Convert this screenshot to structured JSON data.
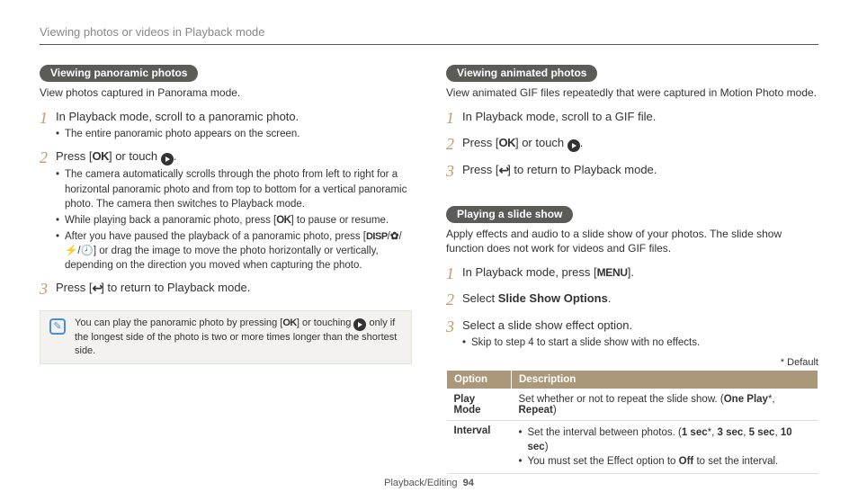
{
  "header": "Viewing photos or videos in Playback mode",
  "footer": {
    "section": "Playback/Editing",
    "page": "94"
  },
  "left": {
    "pill": "Viewing panoramic photos",
    "intro": "View photos captured in Panorama mode.",
    "step1_text": "In Playback mode, scroll to a panoramic photo.",
    "step1_b1": "The entire panoramic photo appears on the screen.",
    "step2_press": "Press [",
    "step2_ok": "OK",
    "step2_or": "] or touch ",
    "step2_dot": ".",
    "step2_b1": "The camera automatically scrolls through the photo from left to right for a horizontal panoramic photo and from top to bottom for a vertical panoramic photo. The camera then switches to Playback mode.",
    "step2_b2a": "While playing back a panoramic photo, press [",
    "step2_b2b": "] to pause or resume.",
    "step2_b3a": "After you have paused the playback of a panoramic photo, press [",
    "step2_b3b": "] or drag the image to move the photo horizontally or vertically, depending on the direction you moved when capturing the photo.",
    "step2_disp": "DISP",
    "step3_press": "Press [",
    "step3_ret": "] to return to Playback mode.",
    "note_a": "You can play the panoramic photo by pressing [",
    "note_ok": "OK",
    "note_b": "] or touching ",
    "note_c": " only if the longest side of the photo is two or more times longer than the shortest side."
  },
  "right_a": {
    "pill": "Viewing animated photos",
    "intro": "View animated GIF files repeatedly that were captured in Motion Photo mode.",
    "step1": "In Playback mode, scroll to a GIF file.",
    "step2_press": "Press [",
    "step2_ok": "OK",
    "step2_or": "] or touch ",
    "step2_dot": ".",
    "step3_press": "Press [",
    "step3_ret": "] to return to Playback mode."
  },
  "right_b": {
    "pill": "Playing a slide show",
    "intro": "Apply effects and audio to a slide show of your photos. The slide show function does not work for videos and GIF files.",
    "step1a": "In Playback mode, press [",
    "step1_menu": "MENU",
    "step1b": "].",
    "step2a": "Select ",
    "step2b": "Slide Show Options",
    "step2c": ".",
    "step3": "Select a slide show effect option.",
    "step3_b1": "Skip to step 4 to start a slide show with no effects.",
    "default": "* Default",
    "th1": "Option",
    "th2": "Description",
    "r1_opt": "Play Mode",
    "r1_a": "Set whether or not to repeat the slide show. (",
    "r1_b": "One Play",
    "r1_c": "*, ",
    "r1_d": "Repeat",
    "r1_e": ")",
    "r2_opt": "Interval",
    "r2_l1a": "Set the interval between photos. (",
    "r2_l1b": "1 sec",
    "r2_l1c": "*, ",
    "r2_l1d": "3 sec",
    "r2_l1e": ", ",
    "r2_l1f": "5 sec",
    "r2_l1g": ", ",
    "r2_l1h": "10 sec",
    "r2_l1i": ")",
    "r2_l2a": "You must set the Effect option to ",
    "r2_l2b": "Off",
    "r2_l2c": " to set the interval."
  }
}
